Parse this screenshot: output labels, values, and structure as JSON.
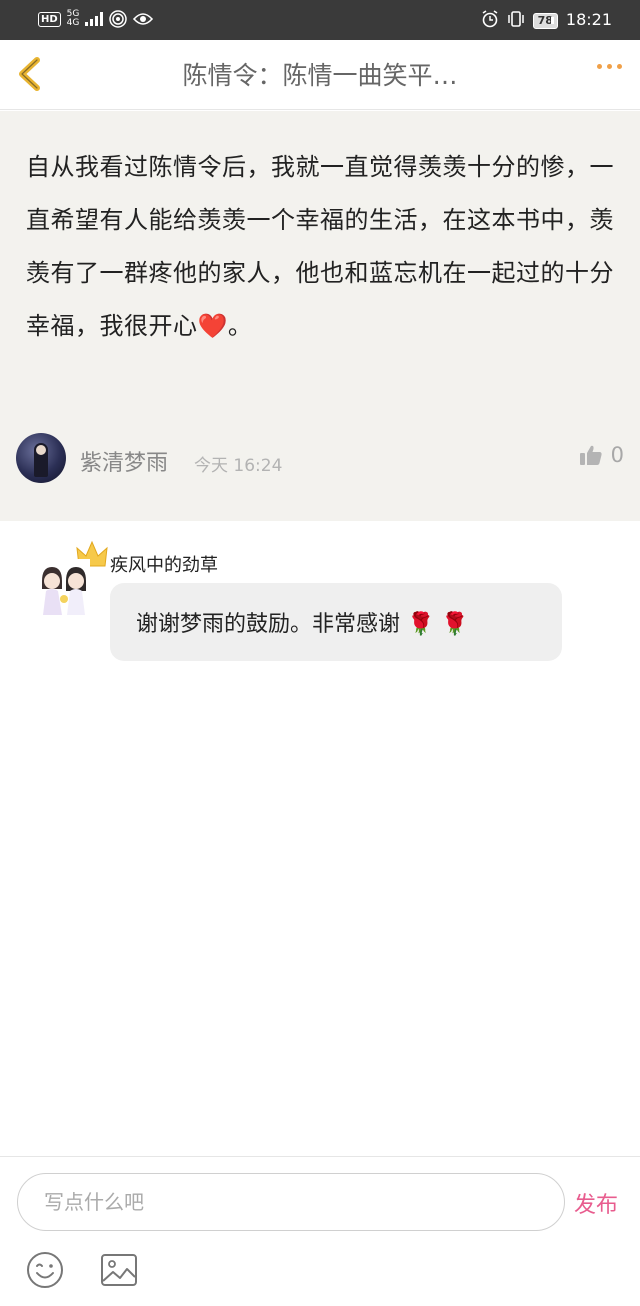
{
  "status_bar": {
    "hd": "HD",
    "network": "5G",
    "network_sub": "4G",
    "battery": "78",
    "time": "18:21"
  },
  "nav": {
    "title": "陈情令：陈情一曲笑平…",
    "accent_color": "#f0a048"
  },
  "post": {
    "text": "自从我看过陈情令后，我就一直觉得羡羡十分的惨，一直希望有人能给羡羡一个幸福的生活，在这本书中，羡羡有了一群疼他的家人，他也和蓝忘机在一起过的十分幸福，我很开心",
    "emoji": "❤️",
    "tail": "。",
    "author": "紫清梦雨",
    "time": "今天 16:24",
    "like_count": "0"
  },
  "reply": {
    "author": "疾风中的劲草",
    "text": "谢谢梦雨的鼓励。非常感谢",
    "emojis": "🌹 🌹"
  },
  "input": {
    "placeholder": "写点什么吧",
    "publish_label": "发布",
    "publish_color": "#e85c8e"
  },
  "icons": [
    "back-chevron-icon",
    "more-dots-icon",
    "thumbs-up-icon",
    "emoji-icon",
    "image-icon"
  ]
}
